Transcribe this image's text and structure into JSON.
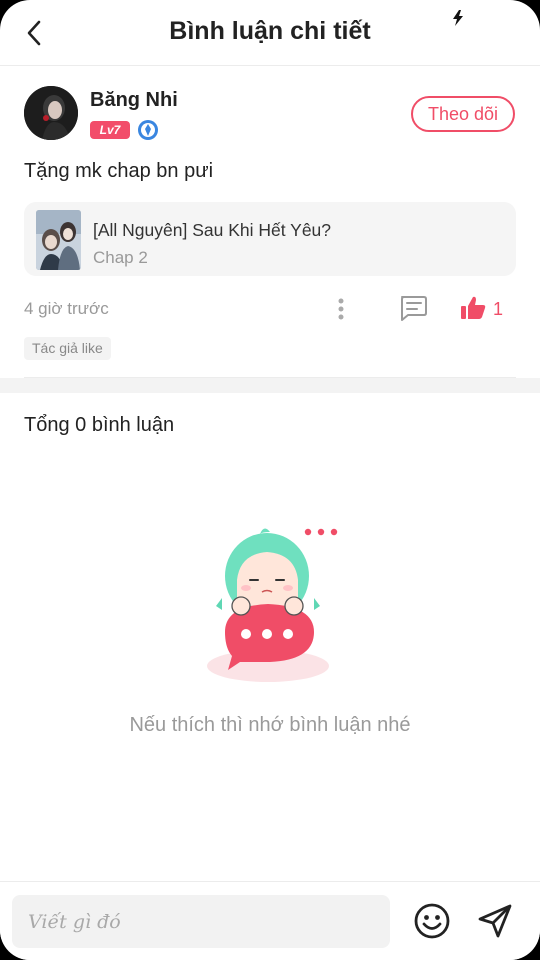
{
  "header": {
    "title": "Bình luận chi tiết",
    "back_icon": "chevron-left-icon",
    "status_icon": "flash-icon"
  },
  "comment": {
    "author": {
      "name": "Băng Nhi",
      "level": "Lv7",
      "medal_icon": "medal-icon"
    },
    "follow_label": "Theo dõi",
    "text": "Tặng mk chap bn pưi",
    "manga": {
      "title": "[All Nguyên] Sau Khi Hết Yêu?",
      "chapter": "Chap 2"
    },
    "time": "4 giờ trước",
    "like_count": "1",
    "author_tag": "Tác giả like"
  },
  "replies": {
    "total_label": "Tổng 0 bình luận",
    "empty_message": "Nếu thích thì nhớ bình luận nhé"
  },
  "input": {
    "placeholder": "Viết gì đó",
    "emoji_icon": "emoji-icon",
    "send_icon": "send-icon"
  },
  "colors": {
    "accent": "#f04d67",
    "level_badge": "#f24d6a",
    "muted_text": "#999999"
  }
}
